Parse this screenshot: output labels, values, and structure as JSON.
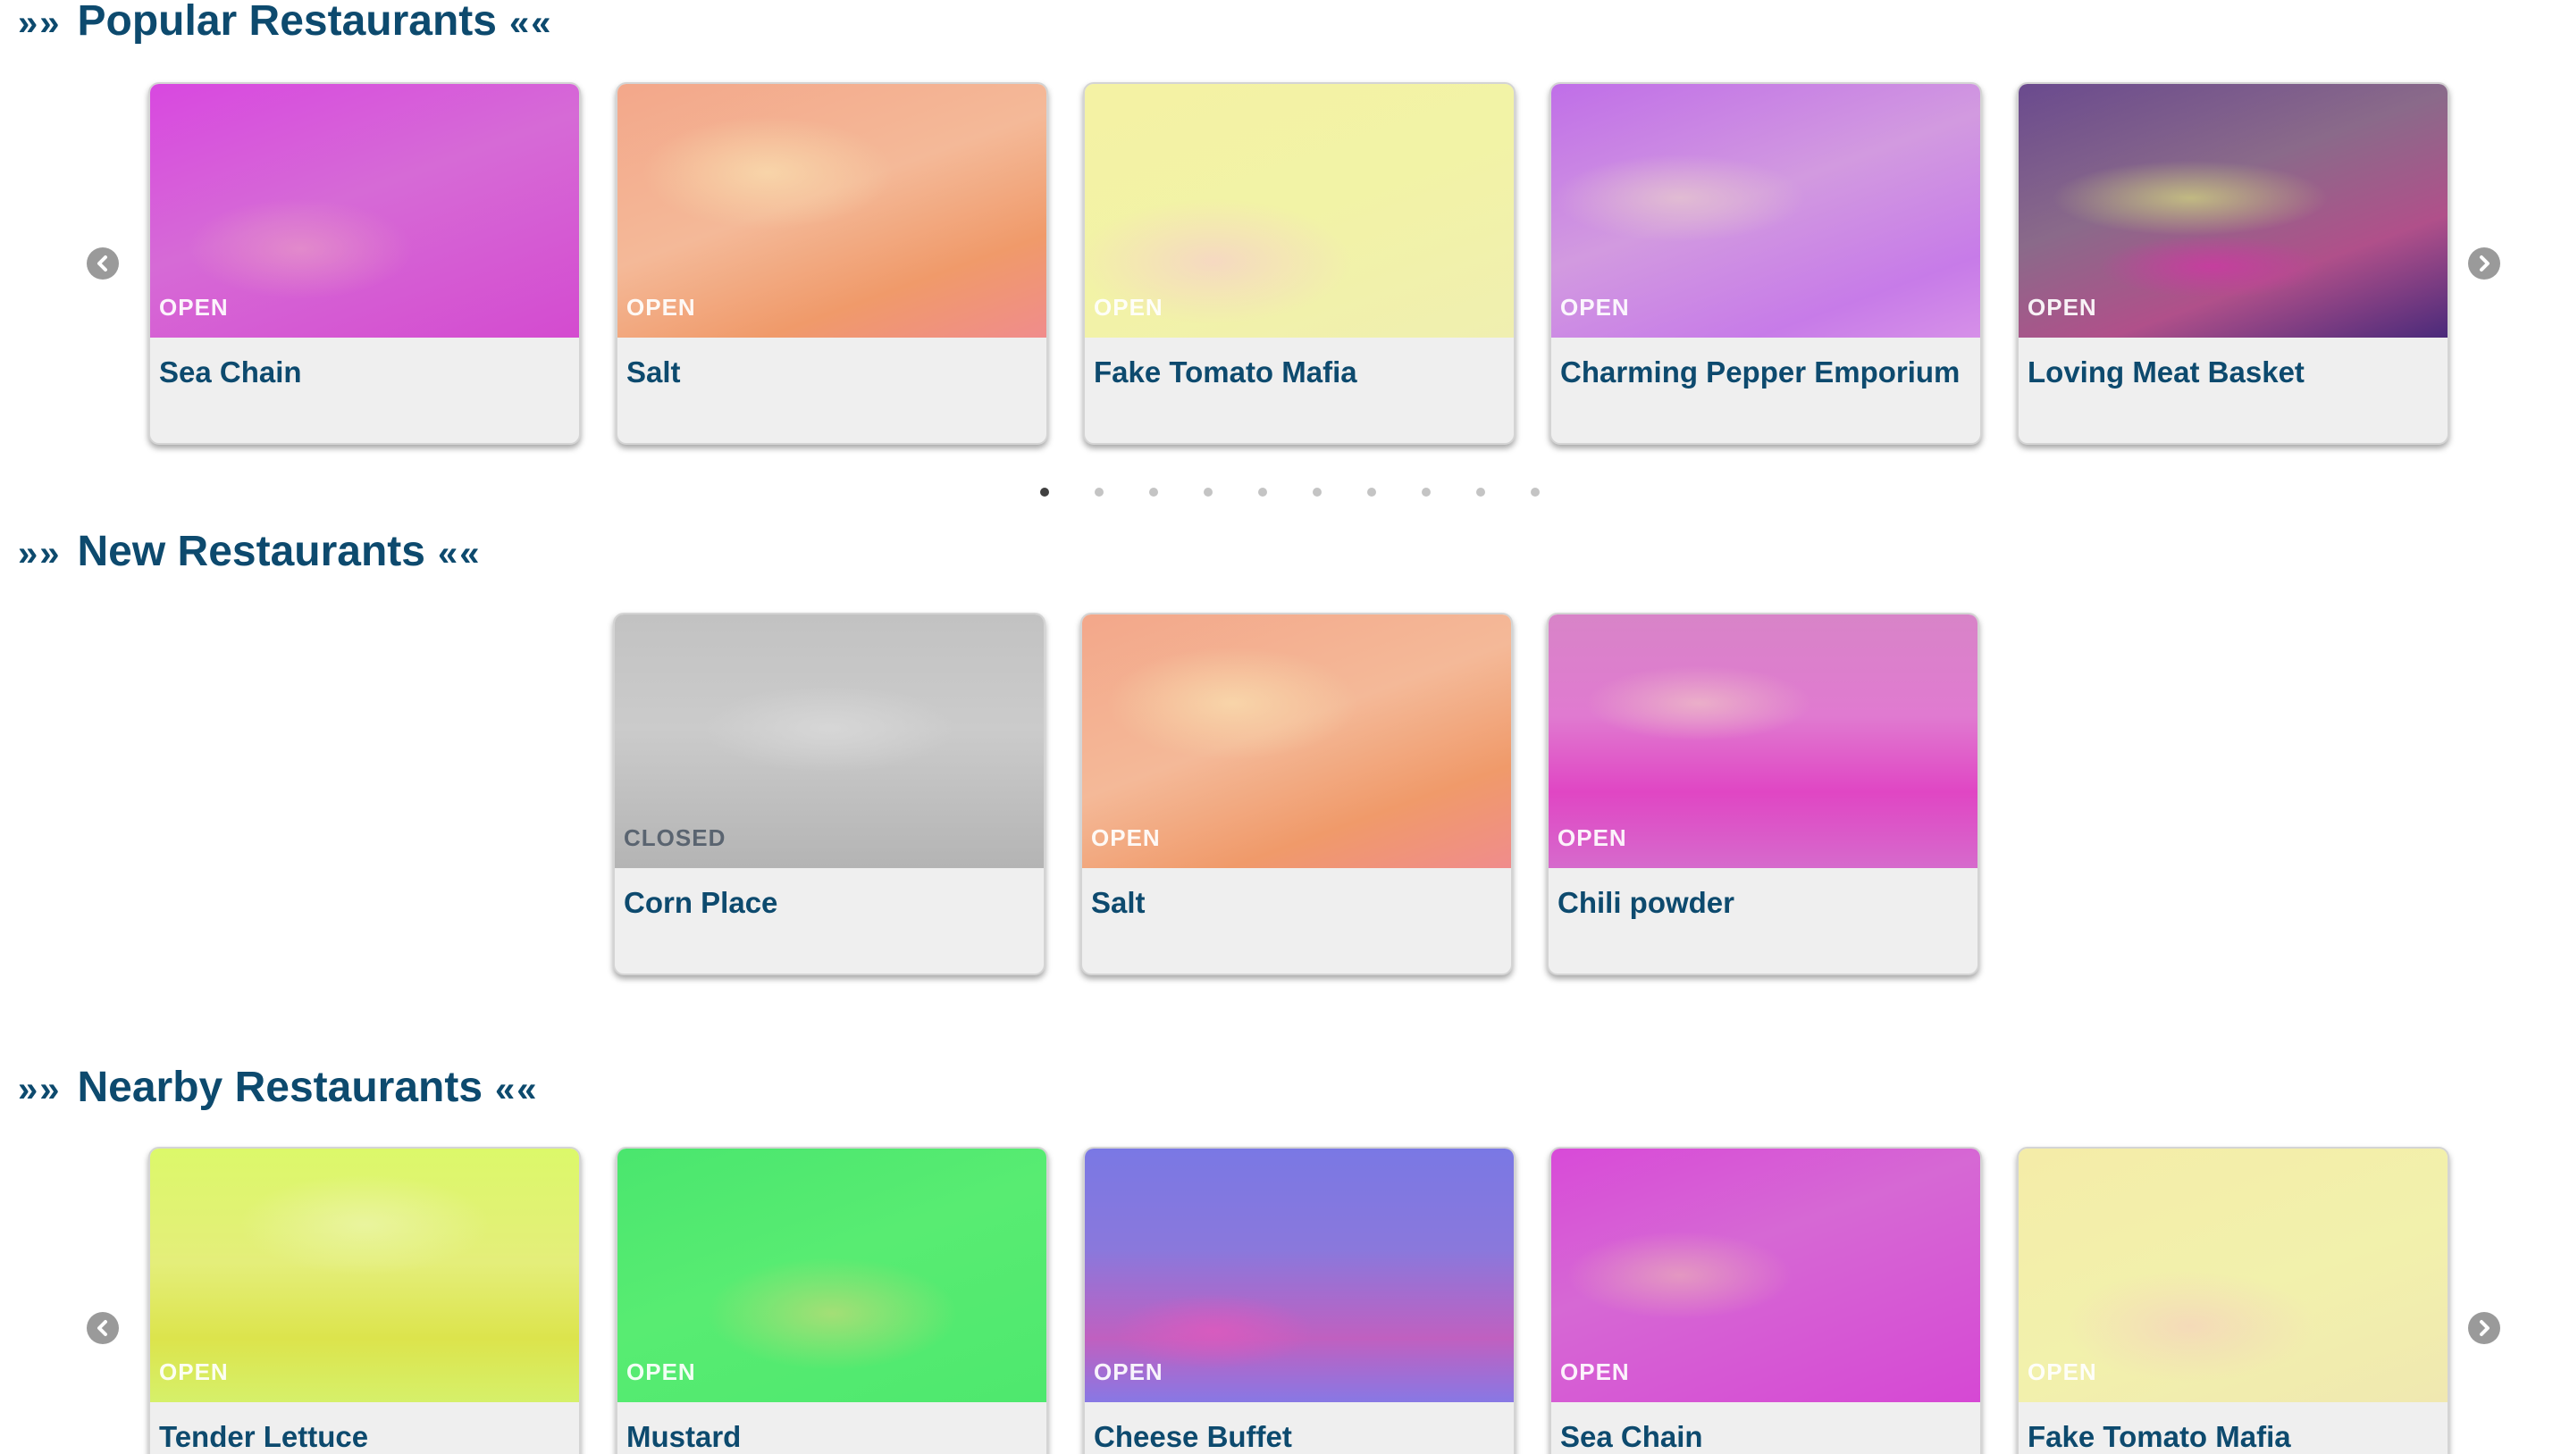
{
  "sections": {
    "popular": {
      "title": "Popular Restaurants",
      "chev_left": "»»",
      "chev_right": "««",
      "cards": [
        {
          "name": "Sea Chain",
          "status": "OPEN"
        },
        {
          "name": "Salt",
          "status": "OPEN"
        },
        {
          "name": "Fake Tomato Mafia",
          "status": "OPEN"
        },
        {
          "name": "Charming Pepper Emporium",
          "status": "OPEN"
        },
        {
          "name": "Loving Meat Basket",
          "status": "OPEN"
        }
      ],
      "pagination": {
        "pages": 10,
        "active": 1
      }
    },
    "new": {
      "title": "New Restaurants",
      "chev_left": "»»",
      "chev_right": "««",
      "cards": [
        {
          "name": "Corn Place",
          "status": "CLOSED"
        },
        {
          "name": "Salt",
          "status": "OPEN"
        },
        {
          "name": "Chili powder",
          "status": "OPEN"
        }
      ]
    },
    "nearby": {
      "title": "Nearby Restaurants",
      "chev_left": "»»",
      "chev_right": "««",
      "cards": [
        {
          "name": "Tender Lettuce",
          "status": "OPEN"
        },
        {
          "name": "Mustard",
          "status": "OPEN"
        },
        {
          "name": "Cheese Buffet",
          "status": "OPEN"
        },
        {
          "name": "Sea Chain",
          "status": "OPEN"
        },
        {
          "name": "Fake Tomato Mafia",
          "status": "OPEN"
        }
      ]
    }
  },
  "icons": {
    "prev": "chevron-left-icon",
    "next": "chevron-right-icon"
  },
  "colors": {
    "heading": "#0d4a6e",
    "card_bg": "#efefef",
    "arrow": "#9a9a9a",
    "dot_active": "#404040",
    "dot_inactive": "#c4c4c4"
  }
}
